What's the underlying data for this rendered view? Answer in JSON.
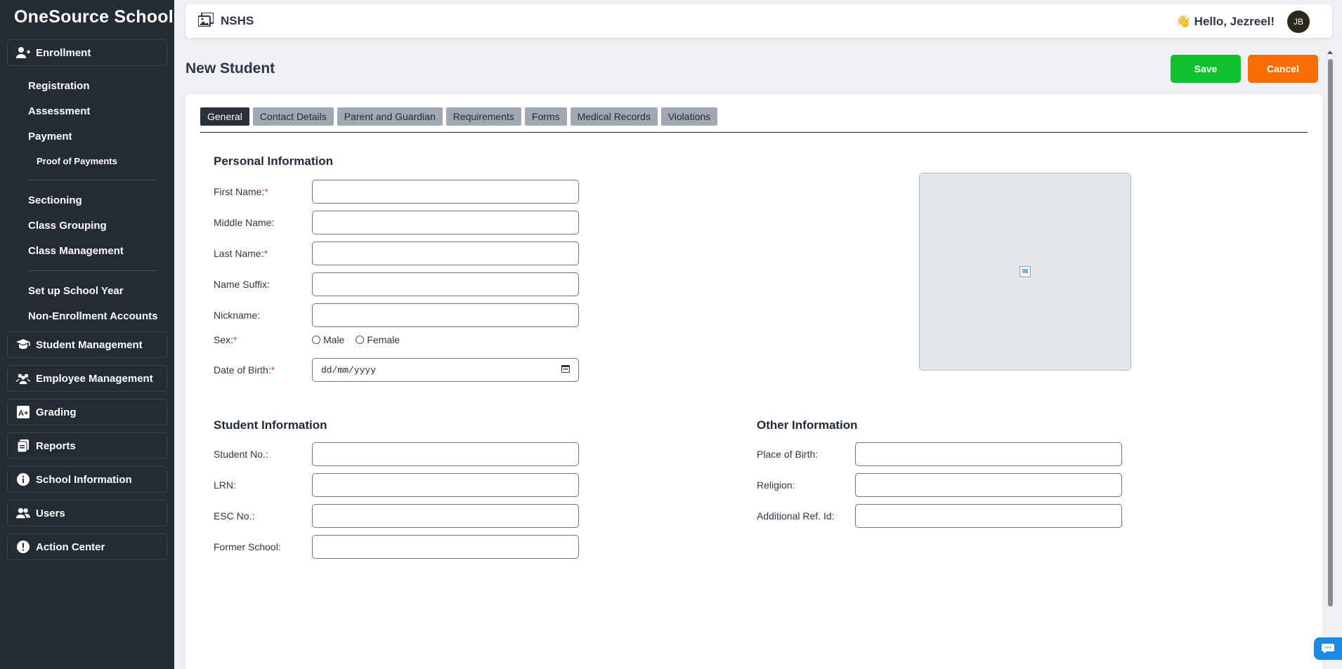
{
  "app": {
    "brand": "OneSource School"
  },
  "topbar": {
    "school": "NSHS",
    "greeting": "👋 Hello, Jezreel!",
    "avatar_initials": "JB"
  },
  "sidebar": {
    "enrollment": {
      "label": "Enrollment",
      "items": [
        "Registration",
        "Assessment",
        "Payment"
      ],
      "sub_item": "Proof of Payments",
      "items2": [
        "Sectioning",
        "Class Grouping",
        "Class Management"
      ],
      "items3": [
        "Set up School Year",
        "Non-Enrollment Accounts"
      ]
    },
    "groups": [
      "Student Management",
      "Employee Management",
      "Grading",
      "Reports",
      "School Information",
      "Users",
      "Action Center"
    ]
  },
  "page": {
    "title": "New Student",
    "save_label": "Save",
    "cancel_label": "Cancel"
  },
  "tabs": [
    "General",
    "Contact Details",
    "Parent and Guardian",
    "Requirements",
    "Forms",
    "Medical Records",
    "Violations"
  ],
  "personal": {
    "title": "Personal Information",
    "first_name": "First Name:",
    "middle_name": "Middle Name:",
    "last_name": "Last Name:",
    "name_suffix": "Name Suffix:",
    "nickname": "Nickname:",
    "sex": "Sex:",
    "male": "Male",
    "female": "Female",
    "dob": "Date of Birth:",
    "dob_placeholder": "dd/mm/yyyy",
    "required_mark": "*"
  },
  "student": {
    "title": "Student Information",
    "student_no": "Student No.:",
    "lrn": "LRN:",
    "esc_no": "ESC No.:",
    "former_school": "Former School:"
  },
  "other": {
    "title": "Other Information",
    "place_of_birth": "Place of Birth:",
    "religion": "Religion:",
    "additional_ref": "Additional Ref. Id:"
  },
  "colors": {
    "save": "#10c130",
    "cancel": "#fa6d05",
    "sidebar": "#252b33"
  }
}
